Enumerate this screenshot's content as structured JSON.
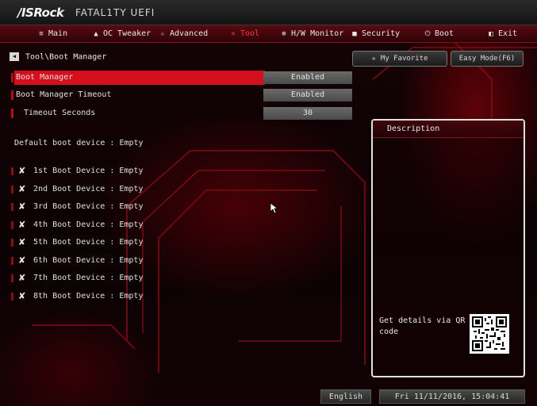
{
  "header": {
    "logo": "/ISRock",
    "logo_sub": "FATAL1TY UEFI"
  },
  "menu": {
    "items": [
      {
        "label": "Main",
        "icon": "list-icon"
      },
      {
        "label": "OC Tweaker",
        "icon": "rocket-icon"
      },
      {
        "label": "Advanced",
        "icon": "star-icon"
      },
      {
        "label": "Tool",
        "icon": "tool-icon",
        "active": true
      },
      {
        "label": "H/W Monitor",
        "icon": "monitor-icon"
      },
      {
        "label": "Security",
        "icon": "shield-icon"
      },
      {
        "label": "Boot",
        "icon": "power-icon"
      },
      {
        "label": "Exit",
        "icon": "exit-icon"
      }
    ]
  },
  "breadcrumb": "Tool\\Boot Manager",
  "favorite_label": "My Favorite",
  "easy_mode_label": "Easy Mode(F6)",
  "settings": [
    {
      "label": "Boot Manager",
      "value": "Enabled"
    },
    {
      "label": "Boot Manager Timeout",
      "value": "Enabled"
    },
    {
      "label": "Timeout Seconds",
      "value": "30"
    }
  ],
  "default_boot": "Default boot device : Empty",
  "boot_devices": [
    "1st Boot Device : Empty",
    "2nd Boot Device : Empty",
    "3rd Boot Device : Empty",
    "4th Boot Device : Empty",
    "5th Boot Device : Empty",
    "6th Boot Device : Empty",
    "7th Boot Device : Empty",
    "8th Boot Device : Empty"
  ],
  "description": {
    "title": "Description",
    "qr_text": "Get details via QR code"
  },
  "footer": {
    "language": "English",
    "datetime": "Fri 11/11/2016, 15:04:41"
  },
  "colors": {
    "accent": "#d3101c",
    "background": "#0a0203"
  }
}
